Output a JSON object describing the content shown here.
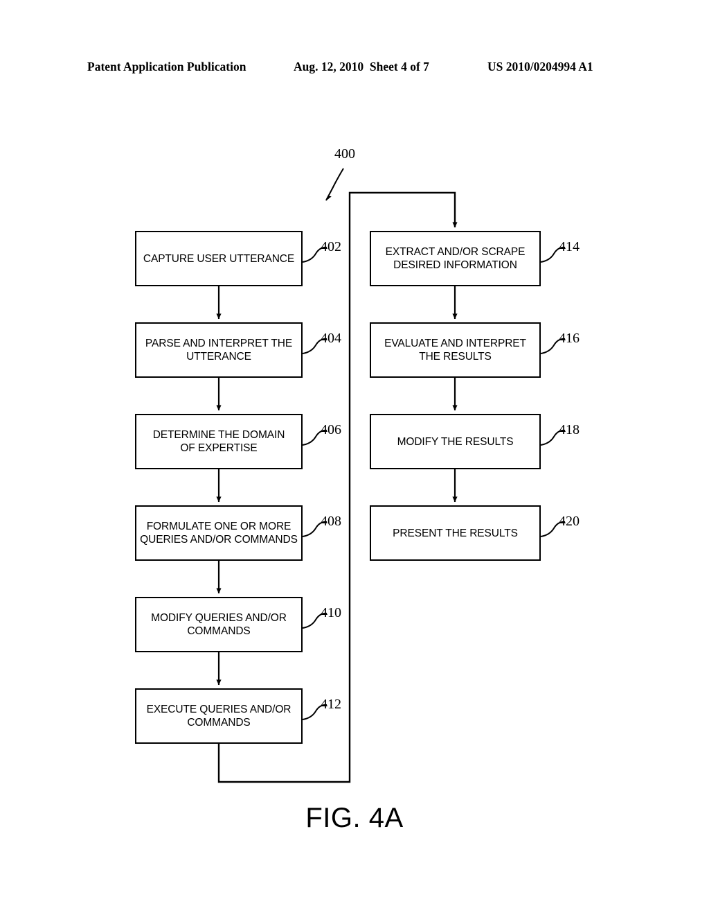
{
  "header": {
    "publication": "Patent Application Publication",
    "date_sheet": "Aug. 12, 2010  Sheet 4 of 7",
    "patent_number": "US 2010/0204994 A1"
  },
  "figure": {
    "caption": "FIG. 4A",
    "diagram_reference": "400"
  },
  "flowchart": {
    "left_column": [
      {
        "ref": "402",
        "lines": [
          "CAPTURE USER UTTERANCE"
        ]
      },
      {
        "ref": "404",
        "lines": [
          "PARSE AND INTERPRET THE",
          "UTTERANCE"
        ]
      },
      {
        "ref": "406",
        "lines": [
          "DETERMINE THE DOMAIN",
          "OF EXPERTISE"
        ]
      },
      {
        "ref": "408",
        "lines": [
          "FORMULATE ONE OR MORE",
          "QUERIES AND/OR COMMANDS"
        ]
      },
      {
        "ref": "410",
        "lines": [
          "MODIFY QUERIES AND/OR",
          "COMMANDS"
        ]
      },
      {
        "ref": "412",
        "lines": [
          "EXECUTE QUERIES AND/OR",
          "COMMANDS"
        ]
      }
    ],
    "right_column": [
      {
        "ref": "414",
        "lines": [
          "EXTRACT AND/OR SCRAPE",
          "DESIRED INFORMATION"
        ]
      },
      {
        "ref": "416",
        "lines": [
          "EVALUATE AND INTERPRET",
          "THE RESULTS"
        ]
      },
      {
        "ref": "418",
        "lines": [
          "MODIFY THE RESULTS"
        ]
      },
      {
        "ref": "420",
        "lines": [
          "PRESENT THE RESULTS"
        ]
      }
    ]
  },
  "colors": {
    "ink": "#000000",
    "background": "#ffffff"
  }
}
